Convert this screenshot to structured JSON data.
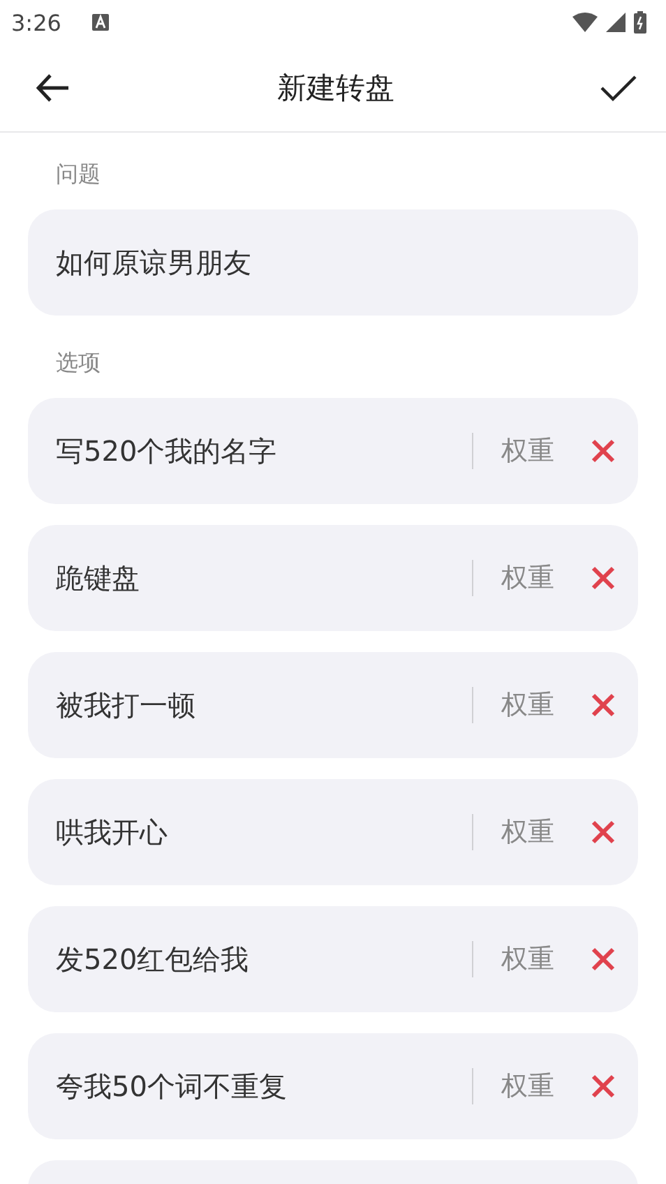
{
  "status_bar": {
    "time": "3:26"
  },
  "header": {
    "title": "新建转盘"
  },
  "question": {
    "label": "问题",
    "value": "如何原谅男朋友"
  },
  "options_label": "选项",
  "options": [
    {
      "value": "写520个我的名字",
      "weight_placeholder": "权重"
    },
    {
      "value": "跪键盘",
      "weight_placeholder": "权重"
    },
    {
      "value": "被我打一顿",
      "weight_placeholder": "权重"
    },
    {
      "value": "哄我开心",
      "weight_placeholder": "权重"
    },
    {
      "value": "发520红包给我",
      "weight_placeholder": "权重"
    },
    {
      "value": "夸我50个词不重复",
      "weight_placeholder": "权重"
    }
  ]
}
